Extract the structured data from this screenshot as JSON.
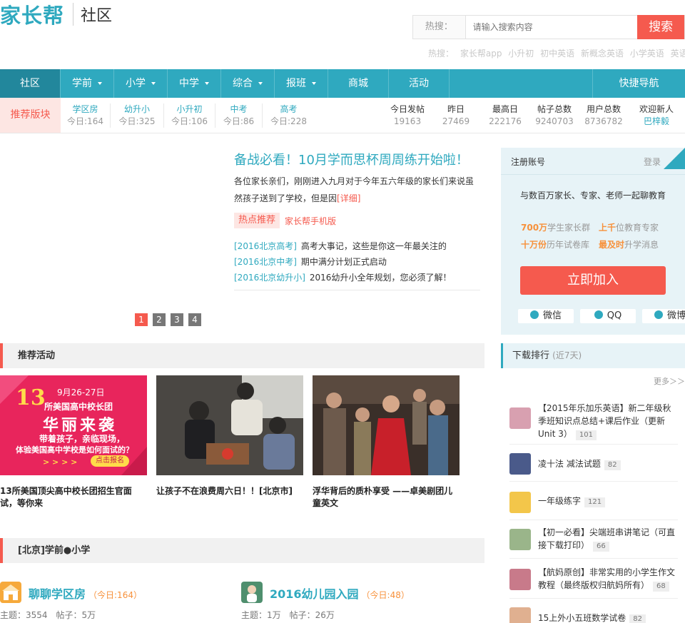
{
  "brand": {
    "logo": "家长帮",
    "sub": "社区"
  },
  "search": {
    "hot_label": "热搜：",
    "placeholder": "请输入搜索内容",
    "button": "搜索"
  },
  "hot_words": {
    "label": "热搜：",
    "items": [
      "家长帮app",
      "小升初",
      "初中英语",
      "新概念英语",
      "小学英语",
      "英语"
    ]
  },
  "nav": {
    "items": [
      {
        "label": "社区",
        "dropdown": false
      },
      {
        "label": "学前",
        "dropdown": true
      },
      {
        "label": "小学",
        "dropdown": true
      },
      {
        "label": "中学",
        "dropdown": true
      },
      {
        "label": "综合",
        "dropdown": true
      },
      {
        "label": "报班",
        "dropdown": true
      },
      {
        "label": "商城",
        "dropdown": false
      },
      {
        "label": "活动",
        "dropdown": false
      }
    ],
    "quick": "快捷导航"
  },
  "subbar": {
    "title": "推荐版块",
    "cats": [
      {
        "name": "学区房",
        "count": "今日:164"
      },
      {
        "name": "幼升小",
        "count": "今日:325"
      },
      {
        "name": "小升初",
        "count": "今日:106"
      },
      {
        "name": "中考",
        "count": "今日:86"
      },
      {
        "name": "高考",
        "count": "今日:228"
      }
    ],
    "stats": [
      {
        "label": "今日发帖",
        "value": "19163"
      },
      {
        "label": "昨日",
        "value": "27469"
      },
      {
        "label": "最高日",
        "value": "222176"
      },
      {
        "label": "帖子总数",
        "value": "9240703"
      },
      {
        "label": "用户总数",
        "value": "8736782"
      },
      {
        "label": "欢迎新人",
        "value": "巴梓毅"
      }
    ]
  },
  "headline": {
    "title": "备战必看！10月学而思杯周周练开始啦！",
    "desc": "各位家长亲们，刚刚进入九月对于今年五六年级的家长们来说虽然孩子送到了学校，但是因",
    "more": "[详细]",
    "tag_hot": "热点推荐",
    "tag_app": "家长帮手机版",
    "news": [
      {
        "cat": "[2016北京高考]",
        "text": "高考大事记，这些是你这一年最关注的"
      },
      {
        "cat": "[2016北京中考]",
        "text": "期中满分计划正式启动"
      },
      {
        "cat": "[2016北京幼升小]",
        "text": "2016幼升小全年规划，您必须了解！"
      }
    ]
  },
  "pager": [
    "1",
    "2",
    "3",
    "4"
  ],
  "activities": {
    "title": "推荐活动",
    "items": [
      {
        "title": "13所美国顶尖高中校长团招生官面试，等你来",
        "banner_date": "9月26-27日",
        "banner_num": "13",
        "banner_l1": "所美国高中校长团",
        "banner_l2": "华丽来袭",
        "banner_l3": "带着孩子，亲临现场，",
        "banner_l4": "体验美国高中学校是如何面试的？",
        "banner_btn": "点击报名",
        "banner_arrows": "> > > >"
      },
      {
        "title": "让孩子不在浪费周六日！！[北京市]"
      },
      {
        "title": "浮华背后的质朴享受 ——卓美剧团儿童英文"
      }
    ]
  },
  "forums": {
    "title": "[北京]学前●小学",
    "items": [
      {
        "name": "聊聊学区房",
        "today": "（今日:164）",
        "meta": "主题：3554　帖子：5万"
      },
      {
        "name": "2016幼儿园入园",
        "today": "（今日:48）",
        "meta": "主题：1万　帖子：26万"
      }
    ]
  },
  "register": {
    "title": "注册账号",
    "login": "登录",
    "slogan": "与数百万家长、专家、老师一起聊教育",
    "f1_b": "700万",
    "f1": "学生家长群",
    "f2_b": "上千",
    "f2": "位教育专家",
    "f3_b": "十万份",
    "f3": "历年试卷库",
    "f4_b": "最及时",
    "f4": "升学消息",
    "join": "立即加入",
    "social": [
      "微信",
      "QQ",
      "微博"
    ]
  },
  "downloads": {
    "title": "下载排行",
    "sub": "(近7天)",
    "more": "更多＞＞",
    "items": [
      {
        "text": "【2015年乐加乐英语】新二年级秋季班知识点总结+课后作业（更新Unit 3）",
        "count": "101"
      },
      {
        "text": "凌十法 减法试题",
        "count": "82"
      },
      {
        "text": "一年级练字",
        "count": "121"
      },
      {
        "text": "【初一必看】尖端班串讲笔记（可直接下载打印）",
        "count": "66"
      },
      {
        "text": "【航妈原创】非常实用的小学生作文教程（最终版权归航妈所有）",
        "count": "68"
      },
      {
        "text": "15上外小五班数学试卷",
        "count": "82"
      }
    ]
  },
  "colors": {
    "brand": "#2fa9bf",
    "accent": "#f55a4e",
    "orange": "#f7913b"
  }
}
